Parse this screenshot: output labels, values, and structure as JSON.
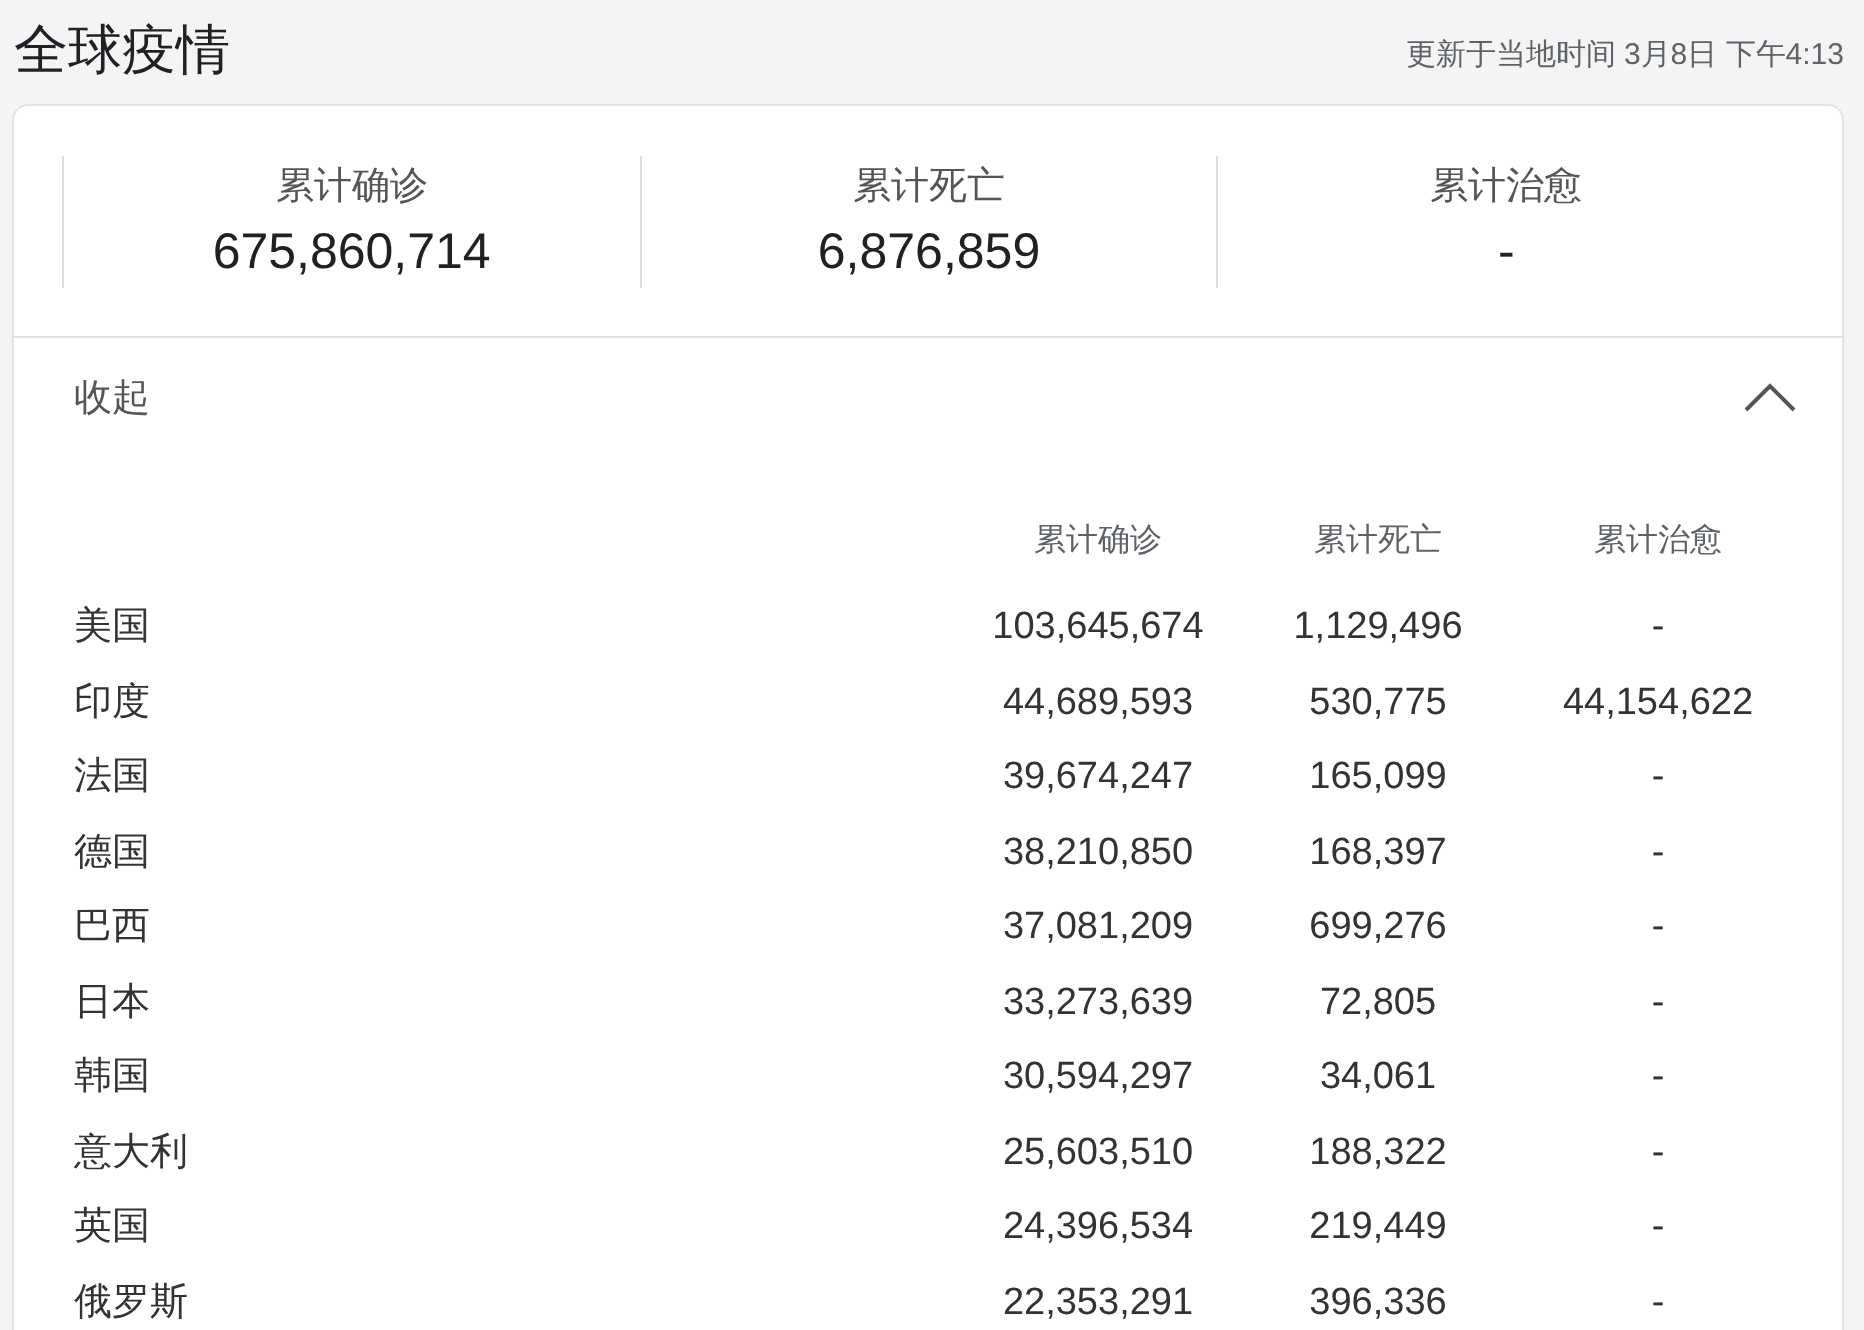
{
  "title": "全球疫情",
  "updated": "更新于当地时间 3月8日 下午4:13",
  "summary": [
    {
      "label": "累计确诊",
      "value": "675,860,714"
    },
    {
      "label": "累计死亡",
      "value": "6,876,859"
    },
    {
      "label": "累计治愈",
      "value": "-"
    }
  ],
  "toggle": {
    "label": "收起",
    "expanded": true
  },
  "table": {
    "columns": [
      "累计确诊",
      "累计死亡",
      "累计治愈"
    ],
    "rows": [
      {
        "region": "美国",
        "cells": [
          "103,645,674",
          "1,129,496",
          "-"
        ]
      },
      {
        "region": "印度",
        "cells": [
          "44,689,593",
          "530,775",
          "44,154,622"
        ]
      },
      {
        "region": "法国",
        "cells": [
          "39,674,247",
          "165,099",
          "-"
        ]
      },
      {
        "region": "德国",
        "cells": [
          "38,210,850",
          "168,397",
          "-"
        ]
      },
      {
        "region": "巴西",
        "cells": [
          "37,081,209",
          "699,276",
          "-"
        ]
      },
      {
        "region": "日本",
        "cells": [
          "33,273,639",
          "72,805",
          "-"
        ]
      },
      {
        "region": "韩国",
        "cells": [
          "30,594,297",
          "34,061",
          "-"
        ]
      },
      {
        "region": "意大利",
        "cells": [
          "25,603,510",
          "188,322",
          "-"
        ]
      },
      {
        "region": "英国",
        "cells": [
          "24,396,534",
          "219,449",
          "-"
        ]
      },
      {
        "region": "俄罗斯",
        "cells": [
          "22,353,291",
          "396,336",
          "-"
        ]
      }
    ]
  }
}
